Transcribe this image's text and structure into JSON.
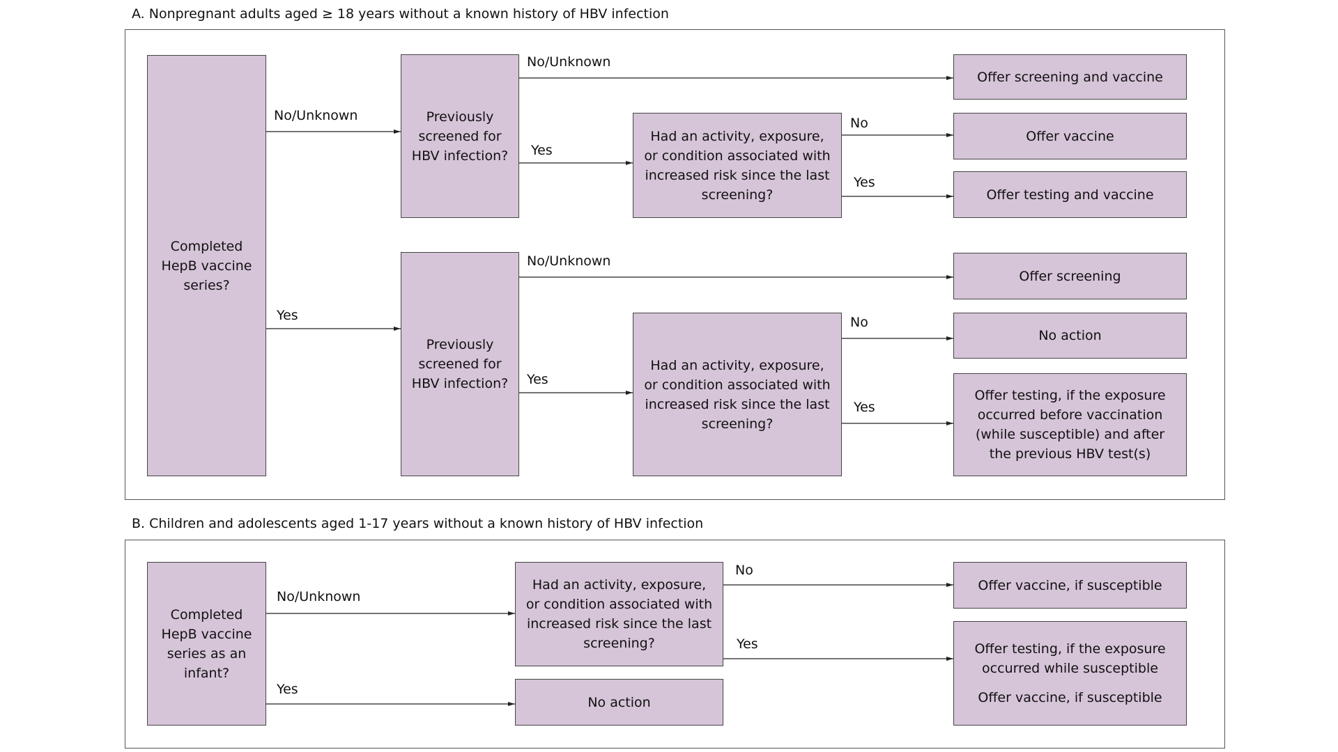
{
  "section_a": {
    "title": "A. Nonpregnant adults aged ≥ 18 years without a known history of HBV infection",
    "start_box": "Completed HepB vaccine series?",
    "screened_box_1": "Previously screened for HBV infection?",
    "screened_box_2": "Previously screened for HBV infection?",
    "risk_box_1": "Had an activity, exposure, or condition associated with increased risk since the last screening?",
    "risk_box_2": "Had an activity, exposure, or condition associated with increased risk since the last screening?",
    "labels": {
      "start_no": "No/Unknown",
      "start_yes": "Yes",
      "screened1_no": "No/Unknown",
      "screened1_yes": "Yes",
      "risk1_no": "No",
      "risk1_yes": "Yes",
      "screened2_no": "No/Unknown",
      "screened2_yes": "Yes",
      "risk2_no": "No",
      "risk2_yes": "Yes"
    },
    "outcomes": [
      "Offer screening and vaccine",
      "Offer vaccine",
      "Offer testing and vaccine",
      "Offer screening",
      "No action",
      "Offer testing, if the exposure occurred before vaccination (while susceptible) and after the previous HBV test(s)"
    ]
  },
  "section_b": {
    "title": "B. Children and adolescents aged 1-17 years without a known history of HBV infection",
    "start_box": "Completed HepB vaccine series as an infant?",
    "risk_box": "Had an activity, exposure, or condition associated with increased risk since the last screening?",
    "labels": {
      "start_no": "No/Unknown",
      "start_yes": "Yes",
      "risk_no": "No",
      "risk_yes": "Yes"
    },
    "no_action_box": "No action",
    "outcome_1": "Offer vaccine, if susceptible",
    "outcome_2_line1": "Offer testing, if the exposure occurred while susceptible",
    "outcome_2_line2": "Offer vaccine, if susceptible"
  },
  "colors": {
    "box_fill": "#d6c4d8",
    "box_border": "#444444",
    "line": "#222222"
  }
}
